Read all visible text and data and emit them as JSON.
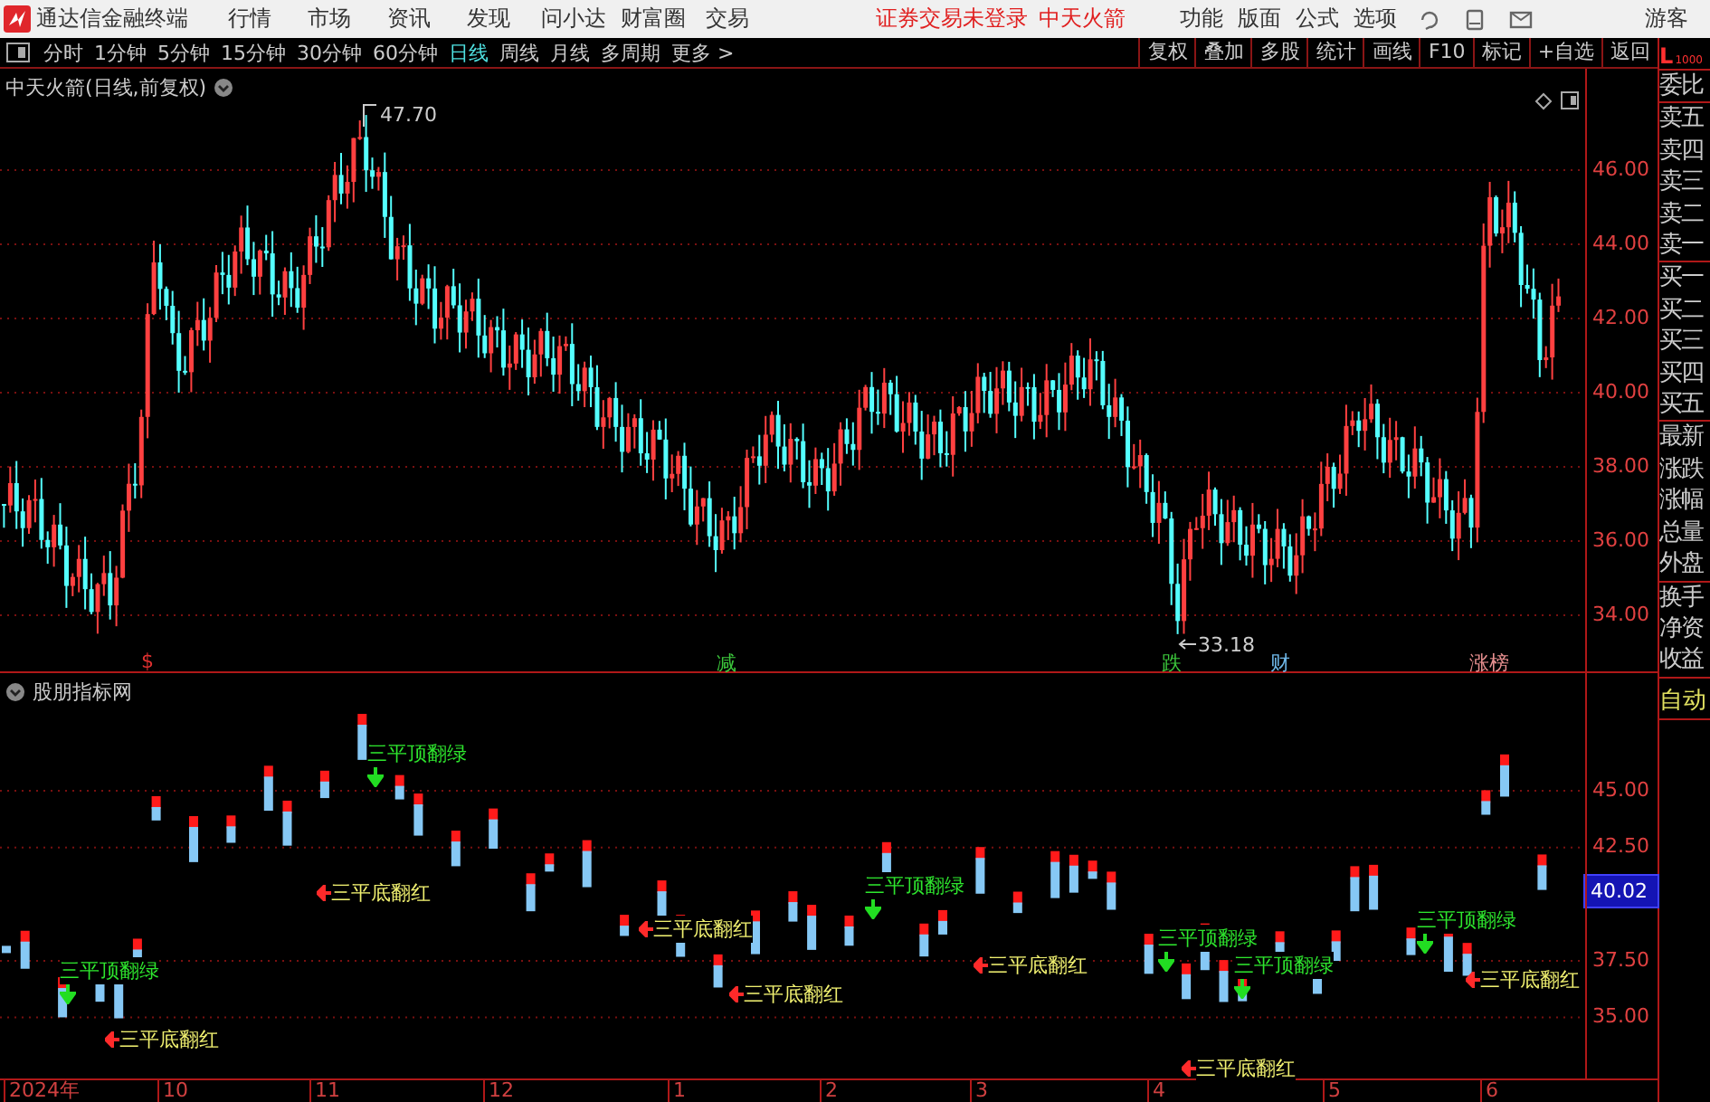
{
  "menubar": {
    "app_title": "通达信金融终端",
    "menus": [
      "行情",
      "市场",
      "资讯",
      "发现",
      "问小达",
      "财富圈",
      "交易"
    ],
    "notice": "证券交易未登录",
    "stock": "中天火箭",
    "right_menus": [
      "功能",
      "版面",
      "公式",
      "选项"
    ],
    "user": "游客"
  },
  "period_tabs": [
    {
      "label": "分时",
      "selected": false
    },
    {
      "label": "1分钟",
      "selected": false
    },
    {
      "label": "5分钟",
      "selected": false
    },
    {
      "label": "15分钟",
      "selected": false
    },
    {
      "label": "30分钟",
      "selected": false
    },
    {
      "label": "60分钟",
      "selected": false
    },
    {
      "label": "日线",
      "selected": true
    },
    {
      "label": "周线",
      "selected": false
    },
    {
      "label": "月线",
      "selected": false
    },
    {
      "label": "多周期",
      "selected": false
    },
    {
      "label": "更多 >",
      "selected": false
    }
  ],
  "tools": [
    "复权",
    "叠加",
    "多股",
    "统计",
    "画线",
    "F10",
    "标记",
    "+自选",
    "返回"
  ],
  "quote_panel": {
    "header": "L",
    "header_sub": "1000",
    "groups": [
      [
        "委比"
      ],
      [
        "卖五",
        "卖四",
        "卖三",
        "卖二",
        "卖一"
      ],
      [
        "买一",
        "买二",
        "买三",
        "买四",
        "买五"
      ],
      [
        "最新",
        "涨跌",
        "涨幅",
        "总量",
        "外盘"
      ],
      [
        "换手",
        "净资",
        "收益"
      ]
    ],
    "auto_button": "自动"
  },
  "price_chart": {
    "title": "中天火箭(日线,前复权)",
    "y_ticks": [
      "46.00",
      "44.00",
      "42.00",
      "40.00",
      "38.00",
      "36.00",
      "34.00"
    ],
    "high_label": "47.70",
    "low_label": "33.18",
    "events": [
      {
        "label": "$",
        "color": "#e03030"
      },
      {
        "label": "减",
        "color": "#3cc83c"
      },
      {
        "label": "跌",
        "color": "#3cc83c"
      },
      {
        "label": "财",
        "color": "#6fb8e8"
      },
      {
        "label": "涨榜",
        "color": "#e89090"
      }
    ]
  },
  "indicator": {
    "title": "股朋指标网",
    "y_ticks": [
      "45.00",
      "42.50",
      "37.50",
      "35.00"
    ],
    "last_value": "40.02",
    "signals": [
      {
        "kind": "top",
        "label": "三平顶翻绿"
      },
      {
        "kind": "bottom",
        "label": "三平底翻红"
      },
      {
        "kind": "top",
        "label": "三平顶翻绿"
      },
      {
        "kind": "bottom",
        "label": "三平底翻红"
      },
      {
        "kind": "bottom",
        "label": "三平底翻红"
      },
      {
        "kind": "bottom",
        "label": "三平底翻红"
      },
      {
        "kind": "top",
        "label": "三平顶翻绿"
      },
      {
        "kind": "bottom",
        "label": "三平底翻红"
      },
      {
        "kind": "top",
        "label": "三平顶翻绿"
      },
      {
        "kind": "top",
        "label": "三平顶翻绿"
      },
      {
        "kind": "bottom",
        "label": "三平底翻红"
      },
      {
        "kind": "top",
        "label": "三平顶翻绿"
      },
      {
        "kind": "bottom",
        "label": "三平底翻红"
      }
    ]
  },
  "date_axis": [
    "2024年",
    "10",
    "11",
    "12",
    "1",
    "2",
    "3",
    "4",
    "5",
    "6"
  ]
}
